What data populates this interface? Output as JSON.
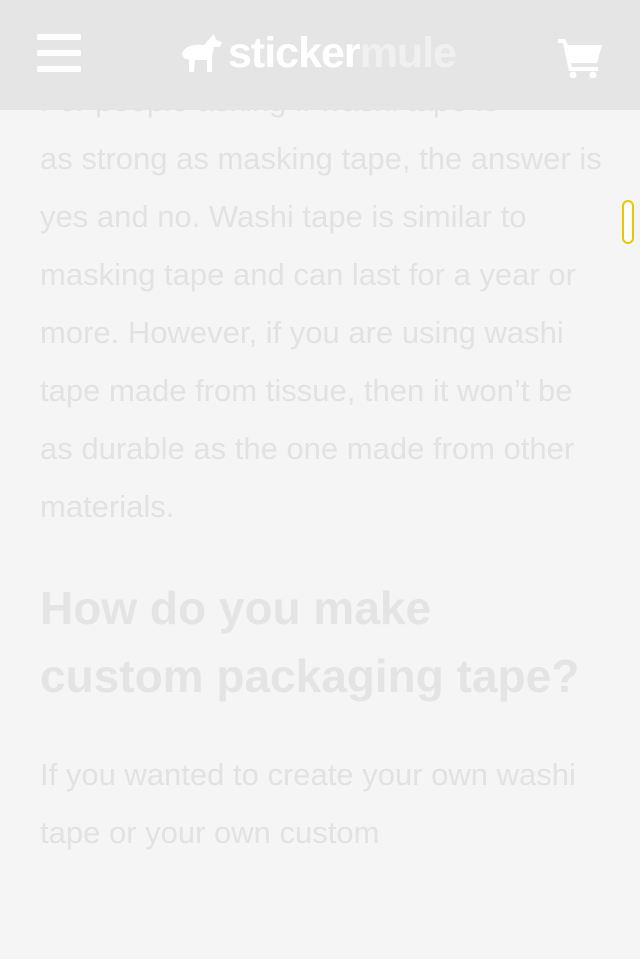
{
  "header": {
    "menu_icon": "hamburger-menu-icon",
    "logo": {
      "part1": "sticker",
      "part2": "mule",
      "icon": "mule-icon"
    },
    "cart_icon": "shopping-cart-icon"
  },
  "article": {
    "partial_line": "For people asking if washi tape is",
    "paragraph1": "as strong as masking tape, the answer is yes and no. Washi tape is similar to masking tape and can last for a year or more. However, if you are using washi tape made from tissue, then it won’t be as durable as the one made from other materials.",
    "heading": "How do you make custom packaging tape?",
    "paragraph2": "If you wanted to create your own washi tape or your own custom"
  },
  "colors": {
    "header_bg": "#e5e5e5",
    "page_bg": "#f5f5f5",
    "scroll_indicator_border": "#e8c800"
  }
}
